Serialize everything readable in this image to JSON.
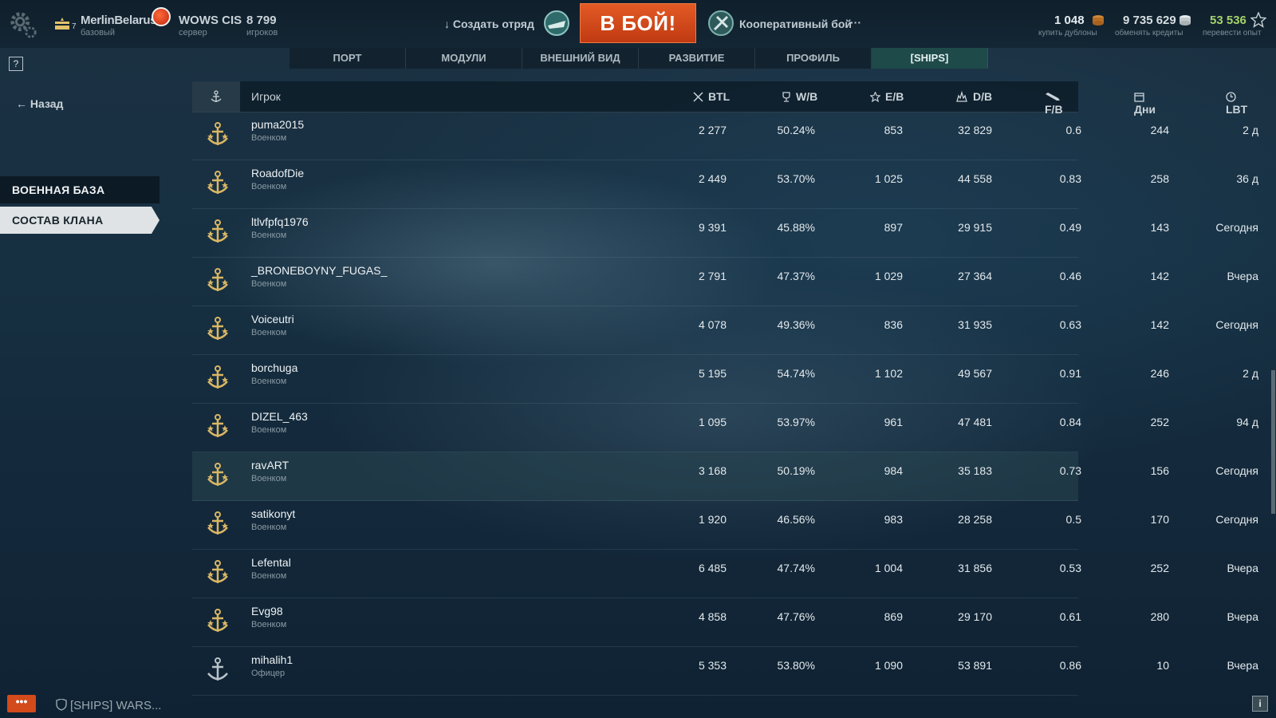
{
  "topbar": {
    "rank_level": "7",
    "player_name": "MerlinBelarus",
    "player_status": "базовый",
    "server_name": "WOWS CIS",
    "server_label": "сервер",
    "online_count": "8 799",
    "online_label": "игроков",
    "create_division_label": "Создать отряд",
    "battle_button_label": "В БОЙ!",
    "battle_mode_label": "Кооперативный бой",
    "more_label": "···",
    "resources": {
      "doubloons": {
        "value": "1 048",
        "label": "купить дублоны",
        "color": "#e8b13c"
      },
      "credits": {
        "value": "9 735 629",
        "label": "обменять кредиты",
        "color": "#d7dee2"
      },
      "free_xp": {
        "value": "53 536",
        "label": "перевести опыт",
        "color": "#a4d36b"
      }
    }
  },
  "help_label": "?",
  "tabs": [
    {
      "label": "ПОРТ"
    },
    {
      "label": "МОДУЛИ"
    },
    {
      "label": "ВНЕШНИЙ ВИД"
    },
    {
      "label": "РАЗВИТИЕ"
    },
    {
      "label": "ПРОФИЛЬ"
    },
    {
      "label": "[SHIPS]",
      "active": true
    }
  ],
  "sidebar": {
    "back_label": "Назад",
    "items": [
      {
        "label": "ВОЕННАЯ БАЗА"
      },
      {
        "label": "СОСТАВ КЛАНА",
        "active": true
      }
    ]
  },
  "table": {
    "headers": {
      "player": "Игрок",
      "btl": "BTL",
      "wr": "W/B",
      "eb": "E/B",
      "db": "D/B",
      "fb": "F/B",
      "days": "Дни",
      "lbt": "LBT"
    },
    "rows": [
      {
        "name": "puma2015",
        "role": "Военком",
        "btl": "2 277",
        "wr": "50.24%",
        "eb": "853",
        "db": "32 829",
        "fb": "0.6",
        "days": "244",
        "lbt": "2 д"
      },
      {
        "name": "RoadofDie",
        "role": "Военком",
        "btl": "2 449",
        "wr": "53.70%",
        "eb": "1 025",
        "db": "44 558",
        "fb": "0.83",
        "days": "258",
        "lbt": "36 д"
      },
      {
        "name": "ltlvfpfq1976",
        "role": "Военком",
        "btl": "9 391",
        "wr": "45.88%",
        "eb": "897",
        "db": "29 915",
        "fb": "0.49",
        "days": "143",
        "lbt": "Сегодня"
      },
      {
        "name": "_BRONEBOYNY_FUGAS_",
        "role": "Военком",
        "btl": "2 791",
        "wr": "47.37%",
        "eb": "1 029",
        "db": "27 364",
        "fb": "0.46",
        "days": "142",
        "lbt": "Вчера"
      },
      {
        "name": "Voiceutri",
        "role": "Военком",
        "btl": "4 078",
        "wr": "49.36%",
        "eb": "836",
        "db": "31 935",
        "fb": "0.63",
        "days": "142",
        "lbt": "Сегодня"
      },
      {
        "name": "borchuga",
        "role": "Военком",
        "btl": "5 195",
        "wr": "54.74%",
        "eb": "1 102",
        "db": "49 567",
        "fb": "0.91",
        "days": "246",
        "lbt": "2 д"
      },
      {
        "name": "DIZEL_463",
        "role": "Военком",
        "btl": "1 095",
        "wr": "53.97%",
        "eb": "961",
        "db": "47 481",
        "fb": "0.84",
        "days": "252",
        "lbt": "94 д"
      },
      {
        "name": "ravART",
        "role": "Военком",
        "btl": "3 168",
        "wr": "50.19%",
        "eb": "984",
        "db": "35 183",
        "fb": "0.73",
        "days": "156",
        "lbt": "Сегодня",
        "selected": true
      },
      {
        "name": "satikonyt",
        "role": "Военком",
        "btl": "1 920",
        "wr": "46.56%",
        "eb": "983",
        "db": "28 258",
        "fb": "0.5",
        "days": "170",
        "lbt": "Сегодня"
      },
      {
        "name": "Lefental",
        "role": "Военком",
        "btl": "6 485",
        "wr": "47.74%",
        "eb": "1 004",
        "db": "31 856",
        "fb": "0.53",
        "days": "252",
        "lbt": "Вчера"
      },
      {
        "name": "Evg98",
        "role": "Военком",
        "btl": "4 858",
        "wr": "47.76%",
        "eb": "869",
        "db": "29 170",
        "fb": "0.61",
        "days": "280",
        "lbt": "Вчера"
      },
      {
        "name": "mihalih1",
        "role": "Офицер",
        "btl": "5 353",
        "wr": "53.80%",
        "eb": "1 090",
        "db": "53 891",
        "fb": "0.86",
        "days": "10",
        "lbt": "Вчера"
      }
    ]
  },
  "footer": {
    "chat_label": "•••",
    "clan_label": "[SHIPS] WARS...",
    "info_label": "i"
  }
}
